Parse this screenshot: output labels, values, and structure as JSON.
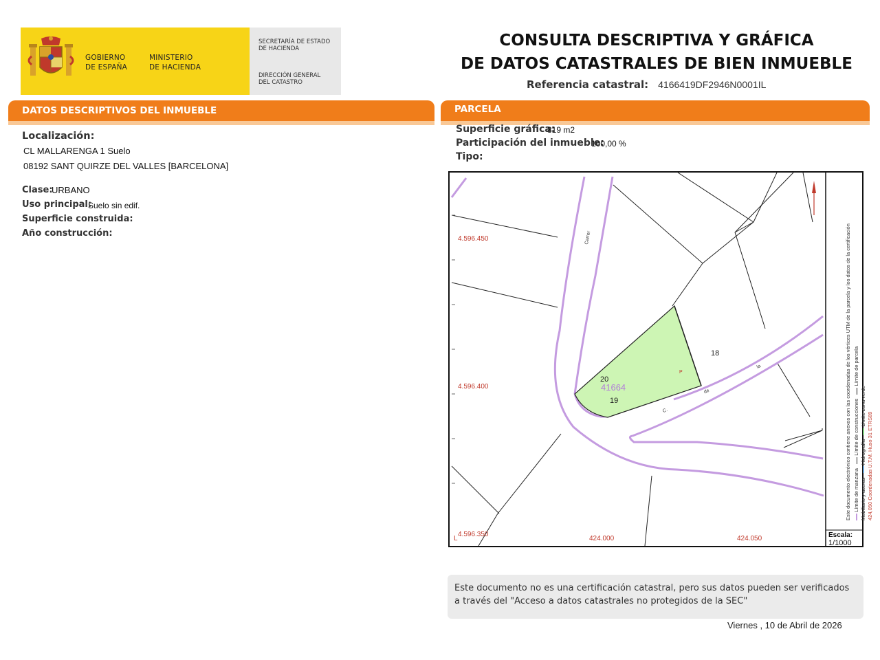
{
  "header": {
    "gov_line1": "GOBIERNO",
    "gov_line2": "DE ESPAÑA",
    "min_line1": "MINISTERIO",
    "min_line2": "DE HACIENDA",
    "sec_line1": "SECRETARÍA DE ESTADO",
    "sec_line2": "DE HACIENDA",
    "dir_line1": "DIRECCIÓN GENERAL",
    "dir_line2": "DEL CATASTRO",
    "title_line1": "CONSULTA DESCRIPTIVA Y GRÁFICA",
    "title_line2": "DE DATOS CATASTRALES DE BIEN INMUEBLE",
    "ref_label": "Referencia catastral:",
    "ref_value": "4166419DF2946N0001IL"
  },
  "left_section": {
    "bar_title": "DATOS DESCRIPTIVOS DEL INMUEBLE",
    "localizacion_label": "Localización:",
    "address_line1": "CL MALLARENGA 1 Suelo",
    "address_line2": "08192 SANT QUIRZE DEL VALLES [BARCELONA]",
    "clase_label": "Clase:",
    "clase_value": "URBANO",
    "uso_label": "Uso principal:",
    "uso_value": "Suelo sin edif.",
    "superficie_label": "Superficie construida:",
    "anio_label": "Año construcción:"
  },
  "right_section": {
    "bar_title": "PARCELA",
    "sup_label": "Superficie gráfica:",
    "sup_value": "819 m2",
    "part_label": "Participación del inmueble:",
    "part_value": "100,00 %",
    "tipo_label": "Tipo:"
  },
  "map": {
    "y_labels": [
      "4.596.450",
      "4.596.400",
      "4.596.350"
    ],
    "x_labels": [
      "424.000",
      "424.050"
    ],
    "corner_label": "L",
    "parcel_number": "41664",
    "parcel_marker": "P",
    "lot_numbers": [
      "20",
      "18",
      "19"
    ],
    "street_words": [
      "Carrer",
      "de",
      "la",
      "C."
    ],
    "legend_items": [
      "Límite de manzana",
      "Límite de construcciones",
      "Límite de parcela",
      "Mobiliario y aceras",
      "Hidrografía",
      "Límite zona verde"
    ],
    "coord_note": "424,050 Coordenadas U.T.M. Huso 31 ETRS89",
    "doc_note": "Este documento electrónico contiene anexos con las coordenadas de los vértices UTM de la parcela y los datos de la certificación",
    "scale_label": "Escala:",
    "scale_value": "1/1000",
    "colors": {
      "street": "#c49be0",
      "parcel_fill": "#cdf5b4",
      "coord_text": "#c0392b"
    }
  },
  "notice": {
    "text": "Este documento no es una certificación catastral, pero sus datos pueden ser verificados a través del \"Acceso a datos catastrales no protegidos de la SEC\""
  },
  "date": "Viernes , 10 de Abril de 2026"
}
